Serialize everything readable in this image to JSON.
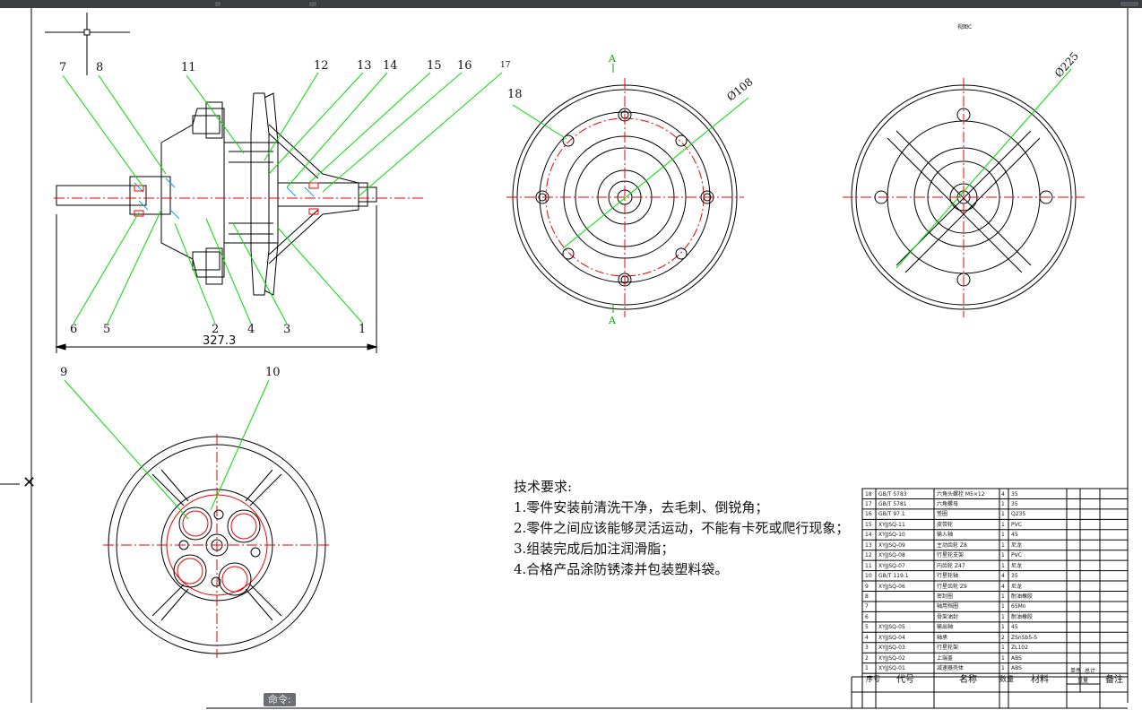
{
  "window": {
    "command_label": "命令:"
  },
  "drawing": {
    "view_mark": "视图C",
    "section_mark": "A",
    "dimensions": {
      "overall_length": "327.3",
      "dia_108": "Ø108",
      "dia_225": "Ø225"
    },
    "balloons": [
      "1",
      "2",
      "3",
      "4",
      "5",
      "6",
      "7",
      "8",
      "9",
      "10",
      "11",
      "12",
      "13",
      "14",
      "15",
      "16",
      "17",
      "18"
    ]
  },
  "tech_requirements": {
    "title": "技术要求:",
    "items": [
      "1.零件安装前清洗干净，去毛刺、倒锐角；",
      "2.零件之间应该能够灵活运动，不能有卡死或爬行现象；",
      "3.组装完成后加注润滑脂；",
      "4.合格产品涂防锈漆并包装塑料袋。"
    ]
  },
  "bom": {
    "header": {
      "seq": "序号",
      "code": "代号",
      "name": "名称",
      "qty": "数量",
      "material": "材料",
      "unit": "单件",
      "total": "总计",
      "weight": "重量",
      "remark": "备注"
    },
    "rows": [
      {
        "seq": "18",
        "code": "GB/T 5783",
        "name": "六角头螺栓 M5×12",
        "qty": "4",
        "material": "35"
      },
      {
        "seq": "17",
        "code": "GB/T 5781",
        "name": "六角螺母",
        "qty": "1",
        "material": "35"
      },
      {
        "seq": "16",
        "code": "GB/T 97.1",
        "name": "垫圈",
        "qty": "1",
        "material": "Q235"
      },
      {
        "seq": "15",
        "code": "XYJJSQ-11",
        "name": "皮带轮",
        "qty": "1",
        "material": "PVC"
      },
      {
        "seq": "14",
        "code": "XYJJSQ-10",
        "name": "输入轴",
        "qty": "1",
        "material": "45"
      },
      {
        "seq": "13",
        "code": "XYJJSQ-09",
        "name": "主动齿轮 Z8",
        "qty": "1",
        "material": "尼龙"
      },
      {
        "seq": "12",
        "code": "XYJJSQ-08",
        "name": "行星轮支架",
        "qty": "1",
        "material": "PVC"
      },
      {
        "seq": "11",
        "code": "XYJJSQ-07",
        "name": "内齿轮 Z47",
        "qty": "1",
        "material": "尼龙"
      },
      {
        "seq": "10",
        "code": "GB/T 119.1",
        "name": "行星轮轴",
        "qty": "4",
        "material": "35"
      },
      {
        "seq": "9",
        "code": "XYJJSQ-06",
        "name": "行星齿轮 Z9",
        "qty": "4",
        "material": "尼龙"
      },
      {
        "seq": "8",
        "code": "",
        "name": "密封圈",
        "qty": "1",
        "material": "耐油橡胶"
      },
      {
        "seq": "7",
        "code": "",
        "name": "轴用挡圈",
        "qty": "1",
        "material": "65Mn"
      },
      {
        "seq": "6",
        "code": "",
        "name": "骨架油封",
        "qty": "1",
        "material": "耐油橡胶"
      },
      {
        "seq": "5",
        "code": "XYJJSQ-05",
        "name": "输出轴",
        "qty": "1",
        "material": "45"
      },
      {
        "seq": "4",
        "code": "XYJJSQ-04",
        "name": "轴承",
        "qty": "2",
        "material": "ZSnSb5-5"
      },
      {
        "seq": "3",
        "code": "XYJJSQ-03",
        "name": "行星轮架",
        "qty": "1",
        "material": "ZL102"
      },
      {
        "seq": "2",
        "code": "XYJJSQ-02",
        "name": "上端盖",
        "qty": "1",
        "material": "ABS"
      },
      {
        "seq": "1",
        "code": "XYJJSQ-01",
        "name": "减速器壳体",
        "qty": "1",
        "material": "ABS"
      }
    ]
  },
  "colors": {
    "outline": "#000000",
    "leader": "#00dd00",
    "center": "#ee0000",
    "background": "#ffffff",
    "titlebar": "#3a3d42"
  }
}
